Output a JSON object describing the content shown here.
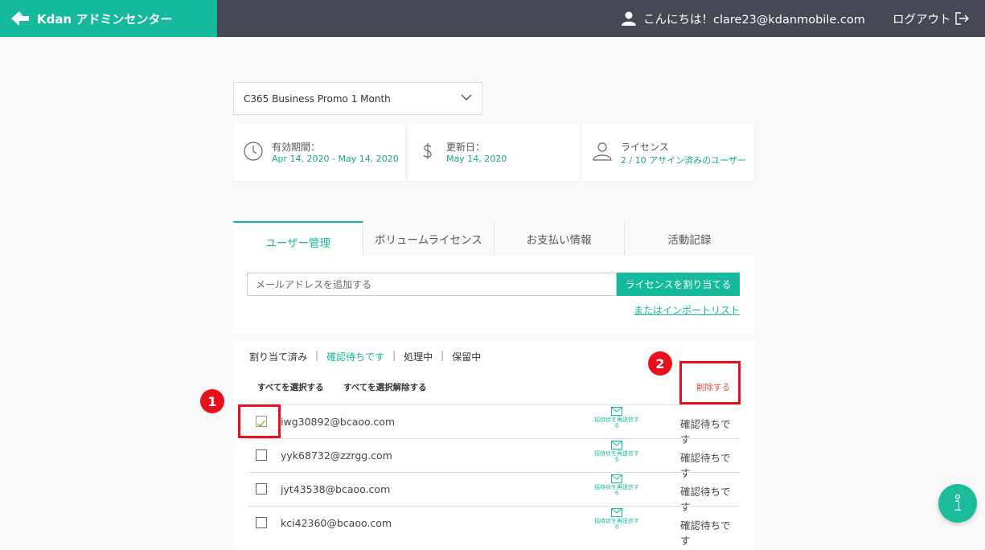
{
  "header": {
    "brand": "Kdan アドミンセンター",
    "greeting": "こんにちは！clare23@kdanmobile.com",
    "logout": "ログアウト"
  },
  "plan": {
    "selected": "C365 Business Promo 1 Month"
  },
  "cards": [
    {
      "label": "有効期間：",
      "value": "Apr 14, 2020 - May 14, 2020",
      "icon": "clock-icon"
    },
    {
      "label": "更新日：",
      "value": "May 14, 2020",
      "icon": "dollar-icon"
    },
    {
      "label": "ライセンス",
      "value": "2 / 10 アサイン済みのユーザー",
      "icon": "user-icon"
    }
  ],
  "tabs": [
    "ユーザー管理",
    "ボリュームライセンス",
    "お支払い情報",
    "活動記録"
  ],
  "add": {
    "placeholder": "メールアドレスを追加する",
    "assign_button": "ライセンスを割り当てる",
    "import_link": "またはインポートリスト"
  },
  "filters": [
    "割り当て済み",
    "確認待ちです",
    "処理中",
    "保留中"
  ],
  "actions": {
    "select_all": "すべてを選択する",
    "deselect_all": "すべてを選択解除する",
    "delete": "削除する"
  },
  "rows": [
    {
      "email": "iwg30892@bcaoo.com",
      "resend": "招待状を再送信する",
      "status": "確認待ちです",
      "checked": true
    },
    {
      "email": "yyk68732@zzrgg.com",
      "resend": "招待状を再送信する",
      "status": "確認待ちです",
      "checked": false
    },
    {
      "email": "jyt43538@bcaoo.com",
      "resend": "招待状を再送信する",
      "status": "確認待ちです",
      "checked": false
    },
    {
      "email": "kci42360@bcaoo.com",
      "resend": "招待状を再送信する",
      "status": "確認待ちです",
      "checked": false
    }
  ],
  "annotations": [
    "1",
    "2"
  ],
  "colors": {
    "brand": "#15b99c",
    "topbar": "#464853",
    "highlight": "#e8101a",
    "delete": "#e74c3c"
  }
}
